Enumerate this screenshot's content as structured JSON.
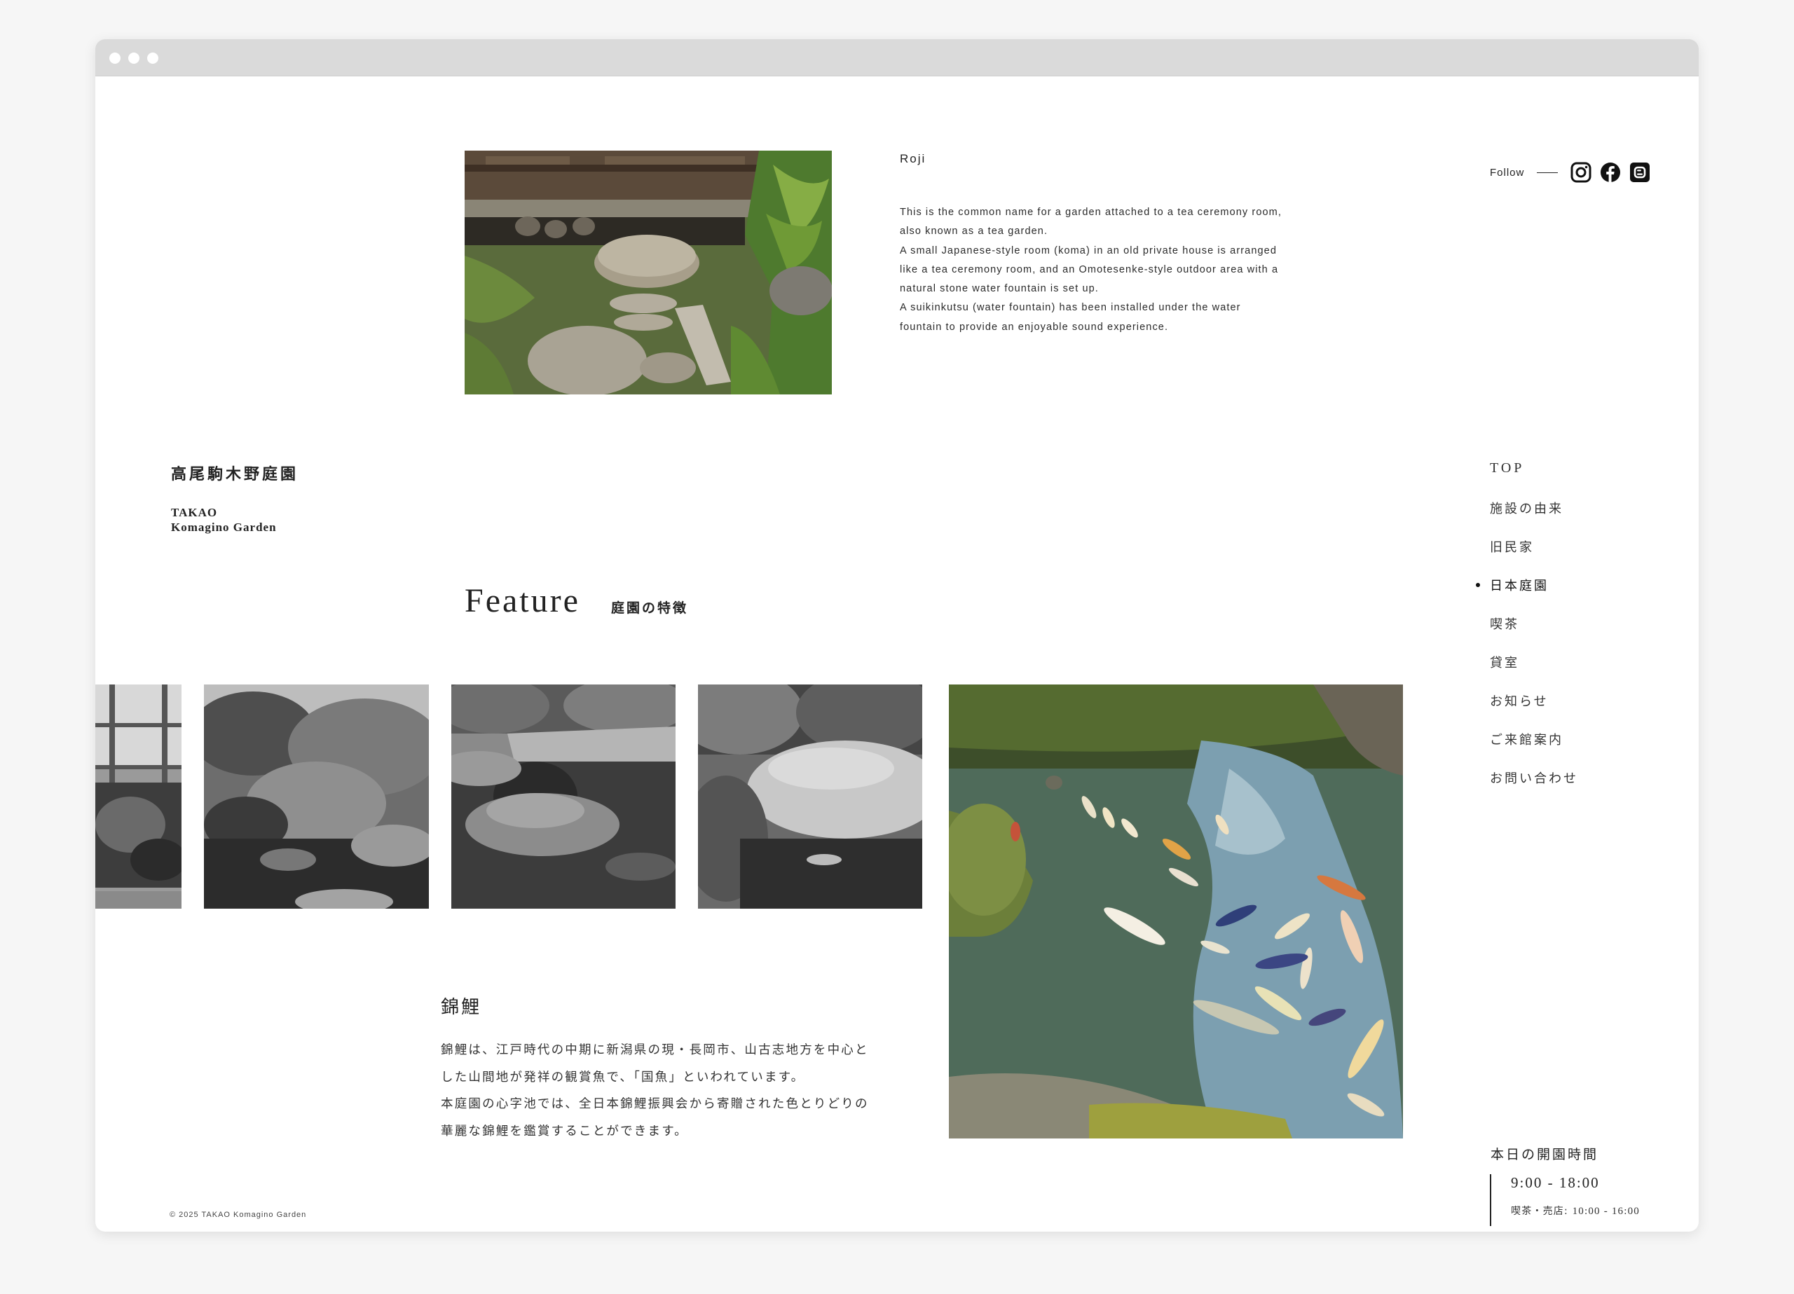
{
  "roji": {
    "title": "Roji",
    "paragraphs": [
      "This is the common name for a garden attached to a tea ceremony room,",
      "also known as a tea garden.",
      "A small Japanese-style room (koma) in an old private house is arranged",
      "like a tea ceremony room, and an Omotesenke-style outdoor area with a",
      "natural stone water fountain is set up.",
      "A suikinkutsu (water fountain) has been installed under the water",
      "fountain to provide an enjoyable sound experience."
    ]
  },
  "follow": {
    "label": "Follow",
    "icons": [
      "instagram-icon",
      "facebook-icon",
      "blogger-icon"
    ]
  },
  "logo": {
    "jp": "高尾駒木野庭園",
    "en_line1": "TAKAO",
    "en_line2": "Komagino Garden"
  },
  "nav": {
    "items": [
      {
        "label": "TOP",
        "active": false
      },
      {
        "label": "施設の由来",
        "active": false
      },
      {
        "label": "旧民家",
        "active": false
      },
      {
        "label": "日本庭園",
        "active": true
      },
      {
        "label": "喫茶",
        "active": false
      },
      {
        "label": "貸室",
        "active": false
      },
      {
        "label": "お知らせ",
        "active": false
      },
      {
        "label": "ご来館案内",
        "active": false
      },
      {
        "label": "お問い合わせ",
        "active": false
      }
    ]
  },
  "feature": {
    "title": "Feature",
    "subtitle": "庭園の特徴"
  },
  "koi": {
    "title": "錦鯉",
    "lines": [
      "錦鯉は、江戸時代の中期に新潟県の現・長岡市、山古志地方を中心と",
      "した山間地が発祥の観賞魚で、「国魚」といわれています。",
      "本庭園の心字池では、全日本錦鯉振興会から寄贈された色とりどりの",
      "華麗な錦鯉を鑑賞することができます。"
    ]
  },
  "footer": {
    "copyright": "© 2025 TAKAO Komagino Garden"
  },
  "hours": {
    "title": "本日の開園時間",
    "main": "9:00 - 18:00",
    "cafe_label": "喫茶・売店: ",
    "cafe_time": "10:00 - 16:00"
  }
}
